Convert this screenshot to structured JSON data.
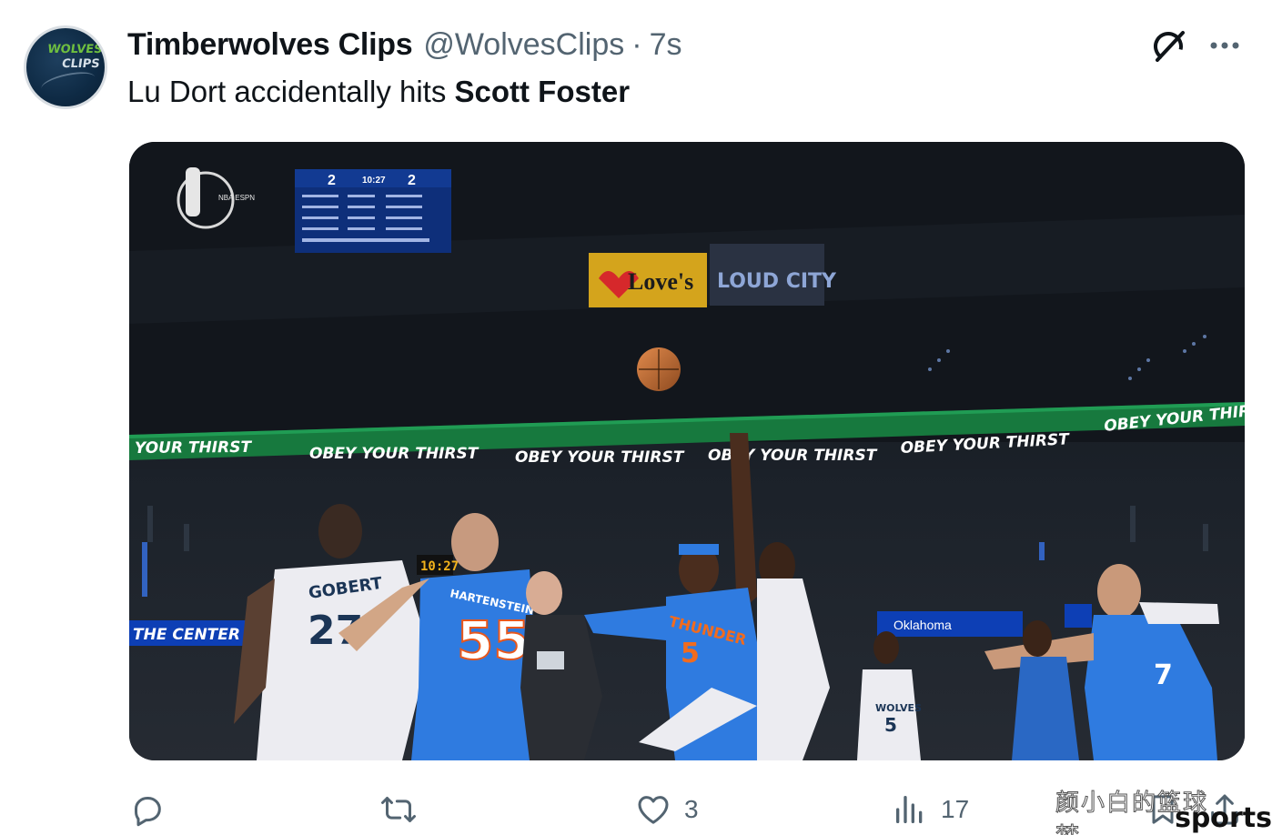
{
  "tweet": {
    "avatar_text_line1": "WOLVES",
    "avatar_text_line2": "CLIPS",
    "display_name": "Timberwolves Clips",
    "handle": "@WolvesClips",
    "separator": "·",
    "time": "7s",
    "text_prefix": "Lu Dort accidentally hits ",
    "text_bold": "Scott Foster",
    "icons": {
      "grok": "grok-icon",
      "more": "more-icon"
    }
  },
  "media": {
    "banner_text": "OBEY YOUR THIRST",
    "banner_left_text": "YOUR THIRST",
    "banner_right_text": "OBEY YOUR THIR",
    "sign_loves": "Love's",
    "sign_loud_city": "LOUD CITY",
    "left_board": "THE CENTER of all",
    "right_board": "Oklahoma",
    "shot_clock": "10:27",
    "scoreboard": {
      "home_score": "2",
      "away_score": "2",
      "clock": "10:27"
    },
    "network_logo": "NBA ESPN",
    "jerseys": {
      "gobert_name": "GOBERT",
      "gobert_number": "27",
      "hartenstein_name": "HARTENSTEIN",
      "hartenstein_number": "55",
      "thunder_text": "THUNDER",
      "thunder_number": "5",
      "wolves_text": "WOLVES",
      "wolves_number": "5",
      "right_player_number": "7"
    },
    "colors": {
      "thunder_blue": "#2f7be0",
      "banner_green": "#1f8f4e",
      "wolves_white": "#ededf2"
    }
  },
  "actions": {
    "reply": {
      "icon": "reply-icon"
    },
    "repost": {
      "icon": "repost-icon"
    },
    "like": {
      "icon": "heart-icon",
      "count": "3"
    },
    "views": {
      "icon": "views-icon",
      "count": "17"
    },
    "bookmark": {
      "icon": "bookmark-icon"
    },
    "share": {
      "icon": "share-icon"
    }
  },
  "watermark": {
    "cn_text": "颜小白的篮球梦",
    "brand": "sports"
  }
}
